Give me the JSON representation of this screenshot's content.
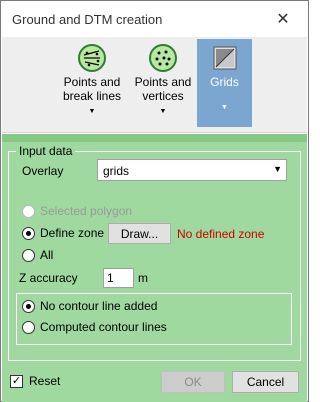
{
  "window": {
    "title": "Ground and DTM creation",
    "close_glyph": "✕"
  },
  "ribbon": {
    "buttons": [
      {
        "label_line1": "Points and",
        "label_line2": "break lines",
        "icon": "points-break-lines-icon",
        "active": false
      },
      {
        "label_line1": "Points and",
        "label_line2": "vertices",
        "icon": "points-vertices-icon",
        "active": false
      },
      {
        "label_line1": "Grids",
        "label_line2": "",
        "icon": "grids-icon",
        "active": true
      }
    ],
    "arrow_glyph": "▼"
  },
  "input_data": {
    "group_title": "Input data",
    "overlay_label": "Overlay",
    "overlay_value": "grids",
    "options": {
      "selected_polygon": "Selected polygon",
      "define_zone": "Define zone",
      "all": "All"
    },
    "selected_option": "define_zone",
    "draw_button": "Draw...",
    "zone_status": "No defined zone",
    "z_accuracy_label": "Z accuracy",
    "z_accuracy_value": "1",
    "z_accuracy_unit": "m",
    "contour": {
      "no_contour": "No contour line added",
      "computed": "Computed contour lines",
      "selected": "no_contour"
    }
  },
  "footer": {
    "reset_label": "Reset",
    "reset_checked": true,
    "ok_label": "OK",
    "cancel_label": "Cancel"
  },
  "colors": {
    "content_bg": "#9fd99f",
    "active_ribbon": "#7ba6cf",
    "error_text": "#cc0000"
  }
}
